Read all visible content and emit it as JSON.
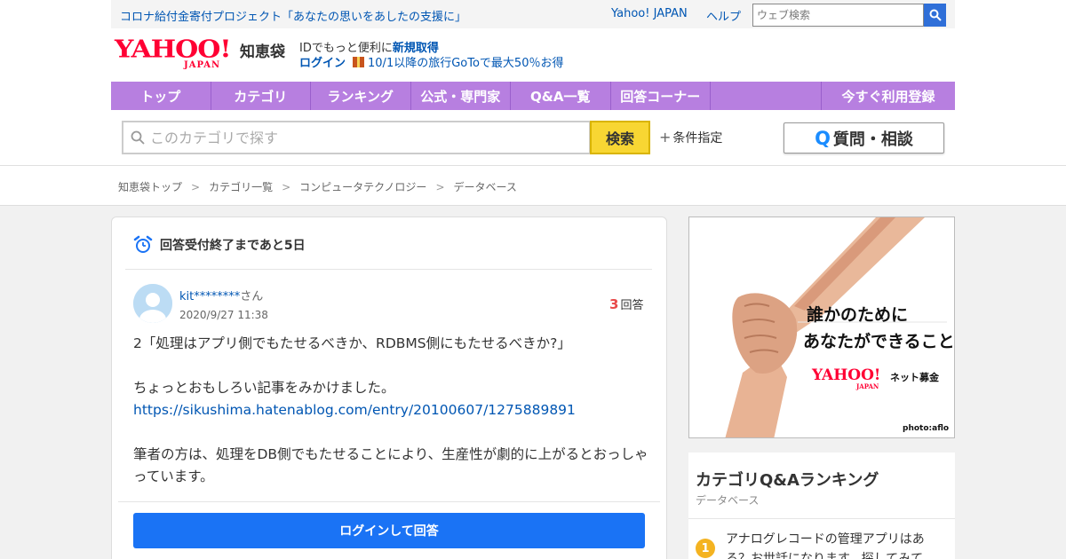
{
  "topbar": {
    "campaign": "コロナ給付金寄付プロジェクト「あなたの思いをあしたの支援に」",
    "yahoo_japan": "Yahoo! JAPAN",
    "help": "ヘルプ",
    "web_search_placeholder": "ウェブ検索"
  },
  "logo": {
    "yahoo": "YAHOO!",
    "japan": "JAPAN",
    "chiebukuro": "知恵袋"
  },
  "account": {
    "id_text": "IDでもっと便利に",
    "register": "新規取得",
    "login": "ログイン",
    "promo": "10/1以降の旅行GoToで最大50％お得"
  },
  "nav": {
    "tabs": [
      "トップ",
      "カテゴリ",
      "ランキング",
      "公式・専門家",
      "Q&A一覧",
      "回答コーナー"
    ],
    "register": "今すぐ利用登録"
  },
  "search": {
    "placeholder": "このカテゴリで探す",
    "button": "検索",
    "conditions": "条件指定",
    "ask_button_q": "Q",
    "ask_button": "質問・相談"
  },
  "breadcrumb": {
    "items": [
      "知恵袋トップ",
      "カテゴリ一覧",
      "コンピュータテクノロジー",
      "データベース"
    ],
    "separator": ">"
  },
  "question": {
    "deadline": "回答受付終了まであと5日",
    "user": "kit********",
    "user_suffix": "さん",
    "date": "2020/9/27 11:38",
    "answer_count": "3",
    "answer_label": "回答",
    "line1": "2「処理はアプリ側でもたせるべきか、RDBMS側にもたせるべきか?」",
    "line2": "ちょっとおもしろい記事をみかけました。",
    "link": "https://sikushima.hatenablog.com/entry/20100607/1275889891",
    "line3": "筆者の方は、処理をDB側でもたせることにより、生産性が劇的に上がるとおっしゃっています。",
    "login_button": "ログインして回答"
  },
  "ad": {
    "line1": "誰かのために",
    "line2": "あなたができること",
    "logo": "YAHOO!",
    "logo_japan": "JAPAN",
    "bokin": "ネット募金",
    "credit": "photo:aflo"
  },
  "ranking": {
    "title": "カテゴリQ&Aランキング",
    "subtitle": "データベース",
    "first_rank": "1",
    "first_text": "アナログレコードの管理アプリはある？お世話になります。探してみて"
  },
  "colors": {
    "nav": "#b77fe0",
    "accent_blue": "#1a73f5",
    "search_yellow": "#f8d633",
    "brand_red": "#ff0033"
  }
}
